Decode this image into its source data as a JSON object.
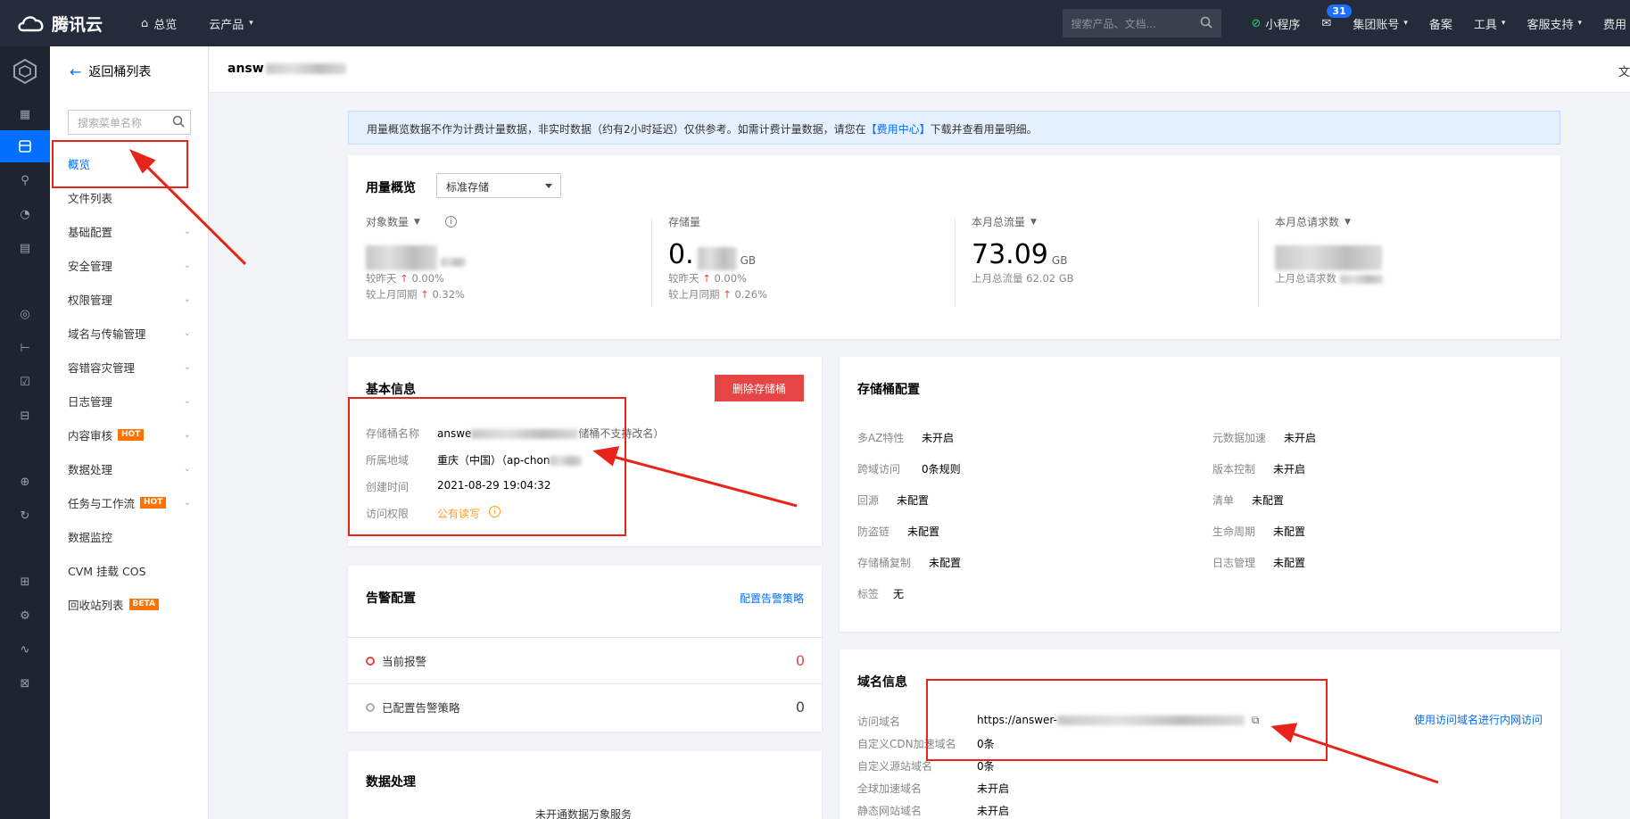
{
  "topbar": {
    "brand": "腾讯云",
    "overview": "总览",
    "products": "云产品",
    "search_placeholder": "搜索产品、文档...",
    "miniprogram": "小程序",
    "mail_badge": "31",
    "group_account": "集团账号",
    "beian": "备案",
    "tools": "工具",
    "support": "客服支持",
    "billing": "费用"
  },
  "subnav": {
    "back_label": "返回桶列表",
    "search_placeholder": "搜索菜单名称",
    "items": [
      {
        "label": "概览"
      },
      {
        "label": "文件列表"
      },
      {
        "label": "基础配置"
      },
      {
        "label": "安全管理"
      },
      {
        "label": "权限管理"
      },
      {
        "label": "域名与传输管理"
      },
      {
        "label": "容错容灾管理"
      },
      {
        "label": "日志管理"
      },
      {
        "label": "内容审核",
        "tag": "HOT"
      },
      {
        "label": "数据处理"
      },
      {
        "label": "任务与工作流",
        "tag": "HOT"
      },
      {
        "label": "数据监控"
      },
      {
        "label": "CVM 挂载 COS"
      },
      {
        "label": "回收站列表",
        "tag": "BETA"
      }
    ]
  },
  "header": {
    "bucket_name_prefix": "answ",
    "right_text": "文"
  },
  "notice": {
    "text_before": "用量概览数据不作为计费计量数据，非实时数据（约有2小时延迟）仅供参考。如需计费计量数据，请您在",
    "link": "【费用中心】",
    "text_after": "下载并查看用量明细。"
  },
  "usage": {
    "title": "用量概览",
    "storage_class": "标准存储",
    "stats": [
      {
        "label": "对象数量",
        "value": "",
        "unit": "",
        "cmp1": "较昨天",
        "cmp1_val": "0.00%",
        "cmp2": "较上月同期",
        "cmp2_val": "0.32%"
      },
      {
        "label": "存储量",
        "value": "0.",
        "unit": "GB",
        "cmp1": "较昨天",
        "cmp1_val": "0.00%",
        "cmp2": "较上月同期",
        "cmp2_val": "0.26%"
      },
      {
        "label": "本月总流量",
        "value": "73.09",
        "unit": "GB",
        "cmp1": "上月总流量 62.02 GB",
        "cmp1_val": "",
        "cmp2": "",
        "cmp2_val": ""
      },
      {
        "label": "本月总请求数",
        "value": "",
        "unit": "",
        "cmp1": "上月总请求数",
        "cmp1_val": "",
        "cmp2": "",
        "cmp2_val": ""
      }
    ]
  },
  "basic": {
    "title": "基本信息",
    "delete_button": "删除存储桶",
    "name_label": "存储桶名称",
    "name_value": "answe",
    "name_note": "储桶不支持改名）",
    "region_label": "所属地域",
    "region_value": "重庆（中国）（ap-chon",
    "created_label": "创建时间",
    "created_value": "2021-08-29 19:04:32",
    "acl_label": "访问权限",
    "acl_value": "公有读写"
  },
  "alarm": {
    "title": "告警配置",
    "config_link": "配置告警策略",
    "current_label": "当前报警",
    "current_count": "0",
    "configured_label": "已配置告警策略",
    "configured_count": "0"
  },
  "processing": {
    "title": "数据处理",
    "text": "未开通数据万象服务"
  },
  "bucket_config": {
    "title": "存储桶配置",
    "left": [
      {
        "k": "多AZ特性",
        "v": "未开启"
      },
      {
        "k": "跨域访问",
        "v": "0条规则"
      },
      {
        "k": "回源",
        "v": "未配置"
      },
      {
        "k": "防盗链",
        "v": "未配置"
      },
      {
        "k": "存储桶复制",
        "v": "未配置"
      },
      {
        "k": "标签",
        "v": "无"
      }
    ],
    "right": [
      {
        "k": "元数据加速",
        "v": "未开启"
      },
      {
        "k": "版本控制",
        "v": "未开启"
      },
      {
        "k": "清单",
        "v": "未配置"
      },
      {
        "k": "生命周期",
        "v": "未配置"
      },
      {
        "k": "日志管理",
        "v": "未配置"
      }
    ]
  },
  "domain": {
    "title": "域名信息",
    "access_label": "访问域名",
    "access_value": "https://answer-",
    "intranet_link": "使用访问域名进行内网访问",
    "cdn_label": "自定义CDN加速域名",
    "cdn_value": "0条",
    "origin_label": "自定义源站域名",
    "origin_value": "0条",
    "global_label": "全球加速域名",
    "global_value": "未开启",
    "static_label": "静态网站域名",
    "static_value": "未开启"
  },
  "colors": {
    "accent": "#006eff",
    "danger": "#e54545",
    "topbar": "#242c3b",
    "annotation": "#e8231a"
  }
}
